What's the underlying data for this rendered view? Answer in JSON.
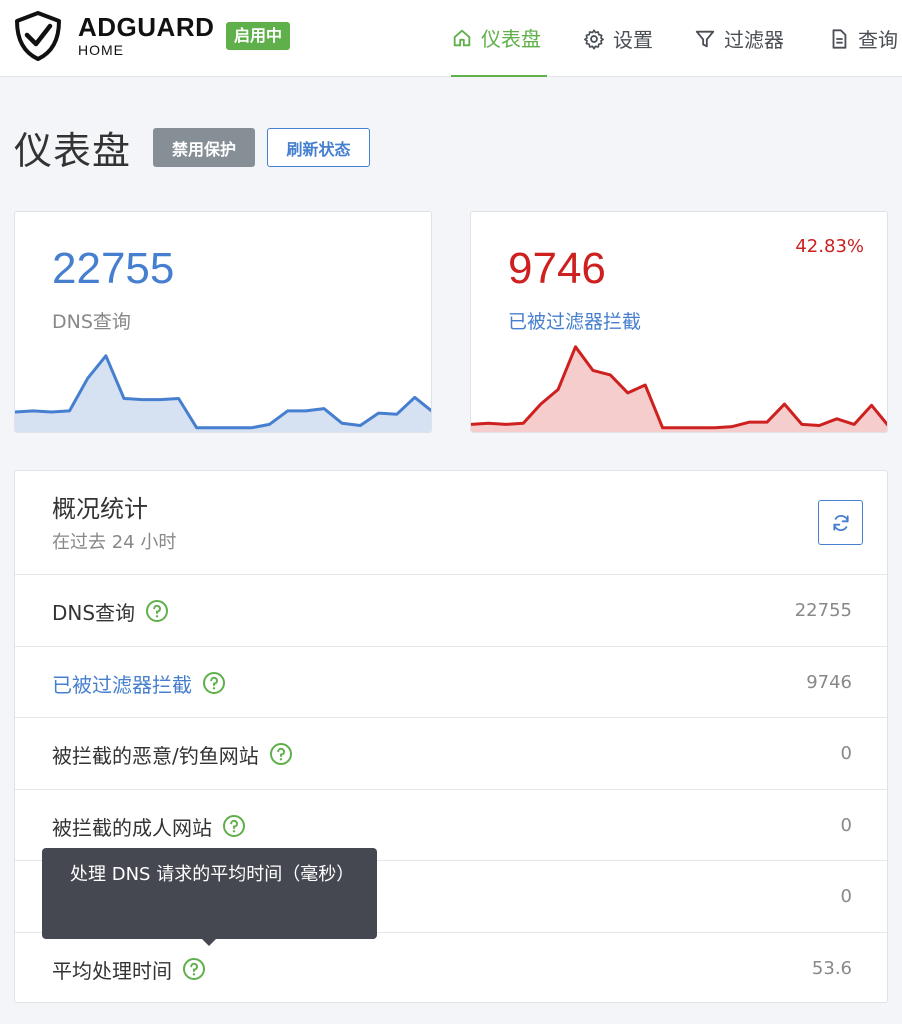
{
  "header": {
    "brand_name": "ADGUARD",
    "brand_sub": "HOME",
    "status_badge": "启用中",
    "nav": {
      "dashboard": "仪表盘",
      "settings": "设置",
      "filters": "过滤器",
      "query_log": "查询"
    }
  },
  "page": {
    "title": "仪表盘",
    "disable_protection": "禁用保护",
    "refresh_status": "刷新状态"
  },
  "cards": {
    "dns_queries": {
      "value": "22755",
      "label": "DNS查询",
      "sparkline": [
        16,
        17,
        16,
        17,
        46,
        66,
        28,
        27,
        27,
        28,
        2,
        2,
        2,
        2,
        5,
        17,
        17,
        19,
        6,
        4,
        15,
        14,
        29,
        16
      ]
    },
    "blocked": {
      "value": "9746",
      "label": "已被过滤器拦截",
      "percent": "42.83%",
      "sparkline": [
        5,
        6,
        5,
        6,
        23,
        36,
        74,
        53,
        49,
        33,
        40,
        2,
        2,
        2,
        2,
        3,
        7,
        7,
        23,
        5,
        4,
        10,
        5,
        22,
        3
      ]
    }
  },
  "overview": {
    "title": "概况统计",
    "subtitle": "在过去 24 小时",
    "rows": [
      {
        "label": "DNS查询",
        "value": "22755"
      },
      {
        "label": "已被过滤器拦截",
        "value": "9746"
      },
      {
        "label": "被拦截的恶意/钓鱼网站",
        "value": "0"
      },
      {
        "label": "被拦截的成人网站",
        "value": "0"
      },
      {
        "label": "",
        "value": "0"
      },
      {
        "label": "平均处理时间",
        "value": "53.6"
      }
    ]
  },
  "tooltip": "处理 DNS 请求的平均时间（毫秒）",
  "colors": {
    "accent_green": "#5fb04a",
    "blue": "#467fcf",
    "red": "#cd201f"
  }
}
